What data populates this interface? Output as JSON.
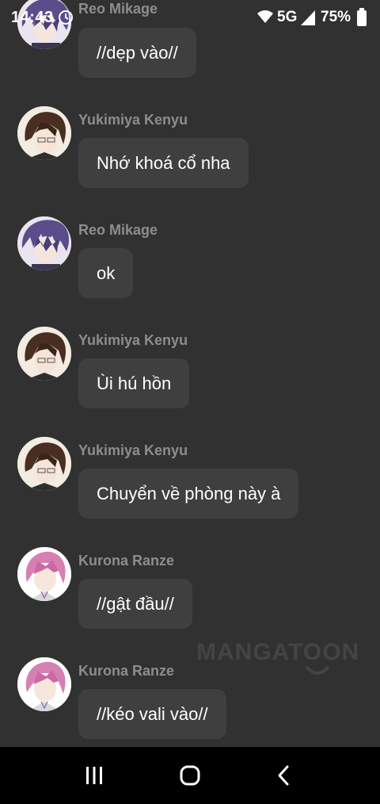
{
  "status_bar": {
    "time": "14:43",
    "network": "5G",
    "battery": "75%",
    "icons": [
      "alarm-icon",
      "wifi-icon",
      "signal-icon",
      "battery-icon"
    ]
  },
  "messages": [
    {
      "sender": "Reo Mikage",
      "text": "//dẹp vào//",
      "avatar": "reo"
    },
    {
      "sender": "Yukimiya Kenyu",
      "text": "Nhớ khoá cổ nha",
      "avatar": "yukimiya"
    },
    {
      "sender": "Reo Mikage",
      "text": "ok",
      "avatar": "reo"
    },
    {
      "sender": "Yukimiya Kenyu",
      "text": "Ùi hú hồn",
      "avatar": "yukimiya"
    },
    {
      "sender": "Yukimiya Kenyu",
      "text": "Chuyển về phòng này à",
      "avatar": "yukimiya"
    },
    {
      "sender": "Kurona Ranze",
      "text": "//gật đầu//",
      "avatar": "kurona"
    },
    {
      "sender": "Kurona Ranze",
      "text": "//kéo vali vào//",
      "avatar": "kurona"
    }
  ],
  "watermark": "MANGATOON",
  "nav_bar": {
    "icons": [
      "recent-apps-icon",
      "home-icon",
      "back-icon"
    ]
  },
  "colors": {
    "background": "#313131",
    "bubble": "#3f3f3f",
    "sender": "#8d8d8d",
    "nav": "#000000"
  }
}
